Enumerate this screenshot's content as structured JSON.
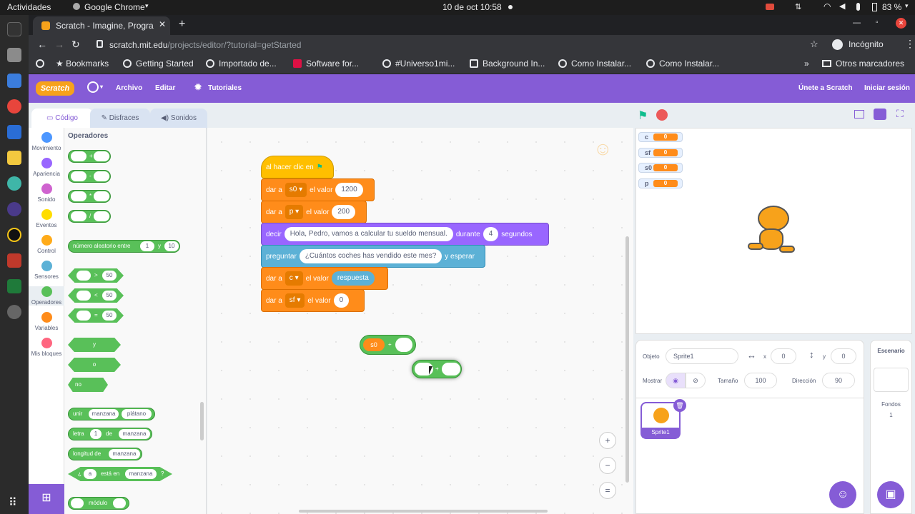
{
  "system": {
    "activities": "Actividades",
    "app": "Google Chrome",
    "datetime": "10 de oct  10:58",
    "battery": "83 %"
  },
  "browser": {
    "tab_title": "Scratch - Imagine, Progra",
    "url_host": "scratch.mit.edu",
    "url_path": "/projects/editor/?tutorial=getStarted",
    "profile": "Incógnito",
    "bookmarks": [
      "Bookmarks",
      "Getting Started",
      "Importado de...",
      "Software for...",
      "#Universo1mi...",
      "Background In...",
      "Como Instalar...",
      "Como Instalar..."
    ],
    "other_bookmarks": "Otros marcadores"
  },
  "menu": {
    "logo": "Scratch",
    "file": "Archivo",
    "edit": "Editar",
    "tutorials": "Tutoriales",
    "join": "Únete a Scratch",
    "signin": "Iniciar sesión"
  },
  "tabs": {
    "code": "Código",
    "costumes": "Disfraces",
    "sounds": "Sonidos"
  },
  "categories": [
    {
      "label": "Movimiento",
      "color": "#4c97ff"
    },
    {
      "label": "Apariencia",
      "color": "#9966ff"
    },
    {
      "label": "Sonido",
      "color": "#cf63cf"
    },
    {
      "label": "Eventos",
      "color": "#ffdd00"
    },
    {
      "label": "Control",
      "color": "#ffab19"
    },
    {
      "label": "Sensores",
      "color": "#5cb1d6"
    },
    {
      "label": "Operadores",
      "color": "#59c059"
    },
    {
      "label": "Variables",
      "color": "#ff8c1a"
    },
    {
      "label": "Mis bloques",
      "color": "#ff6680"
    }
  ],
  "palette": {
    "heading": "Operadores",
    "plus": "+",
    "minus": "-",
    "times": "*",
    "divide": "/",
    "random": "número aleatorio entre",
    "random_from": "1",
    "random_and": "y",
    "random_to": "10",
    "gt": ">",
    "lt": "<",
    "eq": "=",
    "cmp_val": "50",
    "and": "y",
    "or": "o",
    "not": "no",
    "join": "unir",
    "join_a": "manzana",
    "join_b": "plátano",
    "letter": "letra",
    "letter_n": "1",
    "letter_of": "de",
    "letter_word": "manzana",
    "length": "longitud de",
    "length_word": "manzana",
    "contains_q": "¿",
    "contains_a": "a",
    "contains_mid": "está en",
    "contains_word": "manzana",
    "contains_end": "?",
    "mod": "módulo"
  },
  "script": {
    "hat": "al hacer clic en",
    "set1": {
      "a": "dar a",
      "var": "s0",
      "b": "el valor",
      "val": "1200"
    },
    "set2": {
      "a": "dar a",
      "var": "p",
      "b": "el valor",
      "val": "200"
    },
    "say": {
      "a": "decir",
      "msg": "Hola, Pedro, vamos a calcular tu sueldo mensual.",
      "b": "durante",
      "secs": "4",
      "c": "segundos"
    },
    "ask": {
      "a": "preguntar",
      "q": "¿Cuántos coches has vendido este mes?",
      "b": "y esperar"
    },
    "set3": {
      "a": "dar a",
      "var": "c",
      "b": "el valor",
      "val": "respuesta"
    },
    "set4": {
      "a": "dar a",
      "var": "sf",
      "b": "el valor",
      "val": "0"
    },
    "loose_var": "s0",
    "loose_op": "+",
    "drag_op": "+"
  },
  "monitors": [
    {
      "name": "c",
      "value": "0"
    },
    {
      "name": "sf",
      "value": "0"
    },
    {
      "name": "s0",
      "value": "0"
    },
    {
      "name": "p",
      "value": "0"
    }
  ],
  "sprite": {
    "label_object": "Objeto",
    "name": "Sprite1",
    "label_x": "x",
    "x": "0",
    "label_y": "y",
    "y": "0",
    "label_show": "Mostrar",
    "label_size": "Tamaño",
    "size": "100",
    "label_direction": "Dirección",
    "direction": "90",
    "thumb_name": "Sprite1"
  },
  "stage_pane": {
    "title": "Escenario",
    "backdrops_label": "Fondos",
    "backdrops_count": "1"
  }
}
